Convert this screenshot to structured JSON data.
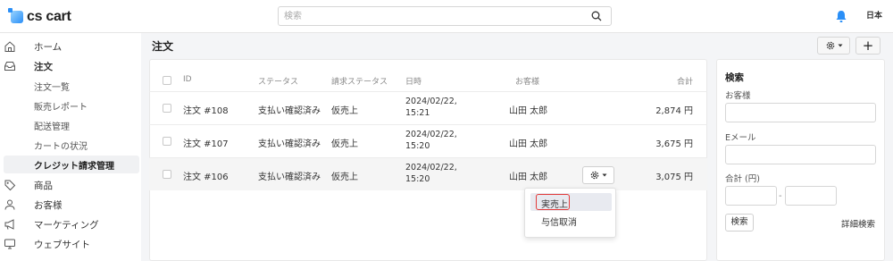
{
  "app": {
    "logo": "cs cart"
  },
  "topbar": {
    "search_placeholder": "検索",
    "language": "日本"
  },
  "sidebar": {
    "items": [
      {
        "label": "ホーム",
        "icon": "home-icon"
      },
      {
        "label": "注文",
        "icon": "inbox-icon"
      },
      {
        "label": "商品",
        "icon": "tag-icon"
      },
      {
        "label": "お客様",
        "icon": "user-icon"
      },
      {
        "label": "マーケティング",
        "icon": "megaphone-icon"
      },
      {
        "label": "ウェブサイト",
        "icon": "monitor-icon"
      }
    ],
    "orders_sub": [
      {
        "label": "注文一覧"
      },
      {
        "label": "販売レポート"
      },
      {
        "label": "配送管理"
      },
      {
        "label": "カートの状況"
      },
      {
        "label": "クレジット請求管理"
      }
    ]
  },
  "page": {
    "title": "注文",
    "add_label": "+"
  },
  "table": {
    "headers": {
      "id": "ID",
      "status": "ステータス",
      "billing_status": "請求ステータス",
      "date": "日時",
      "customer": "お客様",
      "total": "合計"
    },
    "rows": [
      {
        "id": "注文 #108",
        "status": "支払い確認済み",
        "billing_status": "仮売上",
        "date_line1": "2024/02/22,",
        "date_line2": "15:21",
        "customer": "山田 太郎",
        "total": "2,874 円"
      },
      {
        "id": "注文 #107",
        "status": "支払い確認済み",
        "billing_status": "仮売上",
        "date_line1": "2024/02/22,",
        "date_line2": "15:20",
        "customer": "山田 太郎",
        "total": "3,675 円"
      },
      {
        "id": "注文 #106",
        "status": "支払い確認済み",
        "billing_status": "仮売上",
        "date_line1": "2024/02/22,",
        "date_line2": "15:20",
        "customer": "山田 太郎",
        "total": "3,075 円"
      }
    ]
  },
  "dropdown": {
    "items": [
      {
        "label": "実売上"
      },
      {
        "label": "与信取消"
      }
    ]
  },
  "search_panel": {
    "title": "検索",
    "customer_label": "お客様",
    "email_label": "Eメール",
    "total_label": "合計 (円)",
    "range_separator": "-",
    "search_button": "検索",
    "advanced_link": "詳細検索"
  },
  "colors": {
    "accent": "#2a8ff7",
    "bell": "#2a8ff7",
    "focus": "#e23b3b"
  }
}
